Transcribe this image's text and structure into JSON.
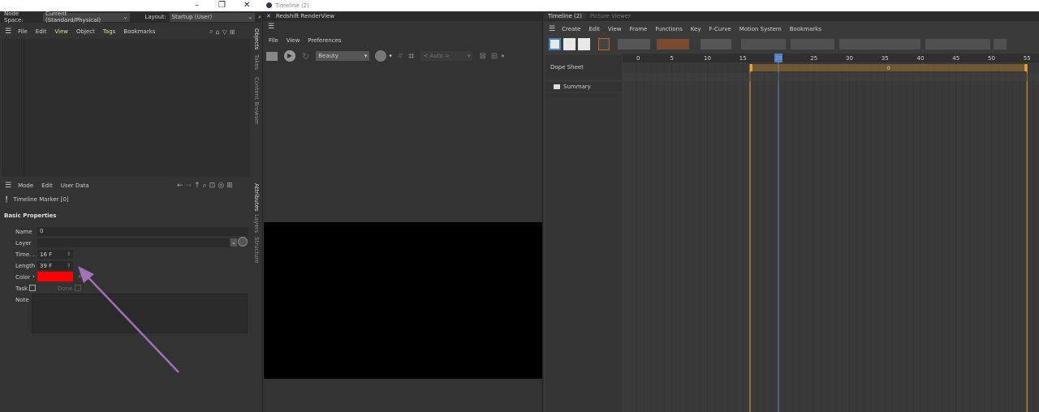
{
  "colors": {
    "accent": "#f0a030",
    "marker_fill": "#a07030",
    "playhead": "#5b8fd6",
    "red": "#ff0000",
    "arrow": "#a070b8"
  },
  "topbar": {
    "node_space_label": "Node Space:",
    "node_space_value": "Current (Standard/Physical)",
    "layout_label": "Layout:",
    "layout_value": "Startup (User)",
    "window_title": "Timeline (2)"
  },
  "objects": {
    "menu": [
      "File",
      "Edit",
      "View",
      "Object",
      "Tags",
      "Bookmarks"
    ],
    "side_tabs": [
      "Objects",
      "Takes",
      "Content Browser"
    ]
  },
  "attributes": {
    "menu": [
      "Mode",
      "Edit",
      "User Data"
    ],
    "object_name": "Timeline Marker [0]",
    "section": "Basic Properties",
    "side_tabs": [
      "Attributes",
      "Layers",
      "Structure"
    ],
    "fields": {
      "name_label": "Name",
      "name_value": "0",
      "layer_label": "Layer",
      "time_label": "Time. . .",
      "time_value": "16 F",
      "length_label": "Length",
      "length_value": "39 F",
      "color_label": "Color",
      "task_label": "Task",
      "done_label": "Done",
      "note_label": "Note"
    }
  },
  "renderview": {
    "title": "Redshift RenderView",
    "menu": [
      "File",
      "View",
      "Preferences"
    ],
    "aov": "Beauty",
    "zoom": "< Auto >"
  },
  "timeline": {
    "tabs": [
      "Timeline (2)",
      "Picture Viewer"
    ],
    "menu": [
      "Create",
      "Edit",
      "View",
      "Frame",
      "Functions",
      "Key",
      "F-Curve",
      "Motion System",
      "Bookmarks"
    ],
    "dope_sheet": "Dope Sheet",
    "summary": "Summary",
    "ruler": [
      0,
      5,
      10,
      15,
      20,
      25,
      30,
      35,
      40,
      45,
      50,
      55
    ],
    "current_frame": 20,
    "marker_start": 16,
    "marker_length": 39,
    "marker_label": "0"
  }
}
